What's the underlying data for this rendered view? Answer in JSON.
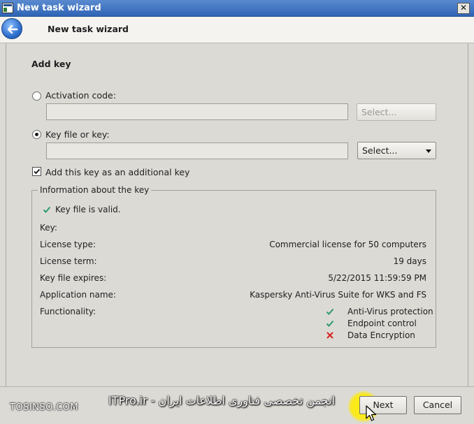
{
  "window": {
    "title": "New task wizard",
    "close_glyph": "✕"
  },
  "header": {
    "title": "New task wizard"
  },
  "section": {
    "title": "Add key"
  },
  "activation": {
    "label": "Activation code:",
    "value": "",
    "select_label": "Select...",
    "selected": false
  },
  "keyfile": {
    "label": "Key file or key:",
    "value": "",
    "select_label": "Select...",
    "selected": true
  },
  "additional_key": {
    "label": "Add this key as an additional key",
    "checked": true
  },
  "info": {
    "legend": "Information about the key",
    "status": "Key file is valid.",
    "key_label": "Key:",
    "key_value": "",
    "license_type_label": "License type:",
    "license_type_value": "Commercial license for 50 computers",
    "license_term_label": "License term:",
    "license_term_value": "19 days",
    "expires_label": "Key file expires:",
    "expires_value": "5/22/2015 11:59:59 PM",
    "app_name_label": "Application name:",
    "app_name_value": "Kaspersky Anti-Virus Suite for WKS and FS",
    "functionality_label": "Functionality:",
    "functionality": [
      {
        "name": "Anti-Virus protection",
        "status": "enabled"
      },
      {
        "name": "Endpoint control",
        "status": "enabled"
      },
      {
        "name": "Data Encryption",
        "status": "disabled"
      }
    ]
  },
  "footer": {
    "watermark_left": "TOSINSO.COM",
    "watermark_center": "ITPro.ir - انجمن تخصصی فناوری اطلاعات ایران",
    "next_label": "Next",
    "cancel_label": "Cancel"
  },
  "colors": {
    "titlebar": "#2f64b5",
    "check_green": "#2e9b6b",
    "cross_red": "#d92020",
    "cursor_highlight": "#ffeb00"
  }
}
